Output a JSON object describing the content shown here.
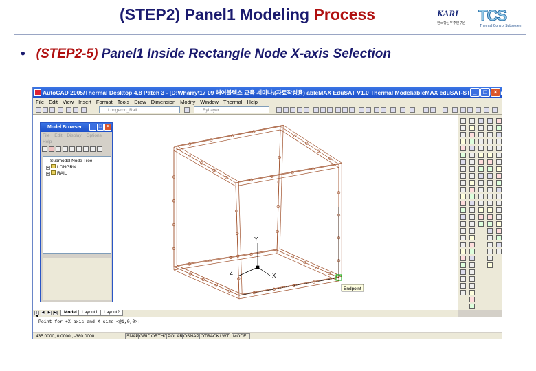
{
  "slide": {
    "title_prefix": "(STEP2) Panel1 Modeling ",
    "title_highlight": "Process",
    "bullet_marker": "•",
    "bullet_step": "(STEP2-5)",
    "bullet_text": "Panel1 Inside Rectangle Node X-axis Selection",
    "logo_kari": "KARI",
    "logo_kari_sub": "한국항공우주연구원",
    "logo_tcs": "TCS",
    "logo_tcs_sub": "Thermal Control Subsystem"
  },
  "app": {
    "title": "AutoCAD 2005/Thermal Desktop 4.8 Patch 3 - [D:Wharry\\17 09 해어블렉스 교육 세미나\\(자료작성용) ableMAX EduSAT V1.0 Thermal Model\\ableMAX eduSAT-STEP1 Longeron....",
    "win_min": "_",
    "win_max": "□",
    "win_close": "×",
    "menu": [
      "File",
      "Edit",
      "View",
      "Insert",
      "Format",
      "Tools",
      "Draw",
      "Dimension",
      "Modify",
      "Window",
      "Thermal",
      "Help"
    ],
    "layer_combo": "Longeron_Rail",
    "linetype_combo": "ByLayer"
  },
  "model_browser": {
    "title": "Model Browser",
    "menu": [
      "File",
      "Edit",
      "Display",
      "Options",
      "Help"
    ],
    "tree_root": "Submodel Node Tree",
    "tree_items": [
      "LONGRN",
      "RAIL"
    ],
    "expander": "+"
  },
  "canvas": {
    "axis_x": "X",
    "axis_y": "Y",
    "axis_z": "Z",
    "snap_tooltip": "Endpoint",
    "line_color": "#a0522d"
  },
  "tabs": {
    "nav": [
      "|◀",
      "◀",
      "▶",
      "▶|"
    ],
    "items": [
      "Model",
      "Layout1",
      "Layout2"
    ]
  },
  "command": {
    "line1": "",
    "line2": "Point for +X axis and X-size <@1,0,0>:"
  },
  "status": {
    "coords": "435.0000,  0.0000  ,  -380.0000",
    "buttons": [
      "SNAP",
      "GRID",
      "ORTHO",
      "POLAR",
      "OSNAP",
      "OTRACK",
      "LWT",
      "MODEL"
    ]
  }
}
